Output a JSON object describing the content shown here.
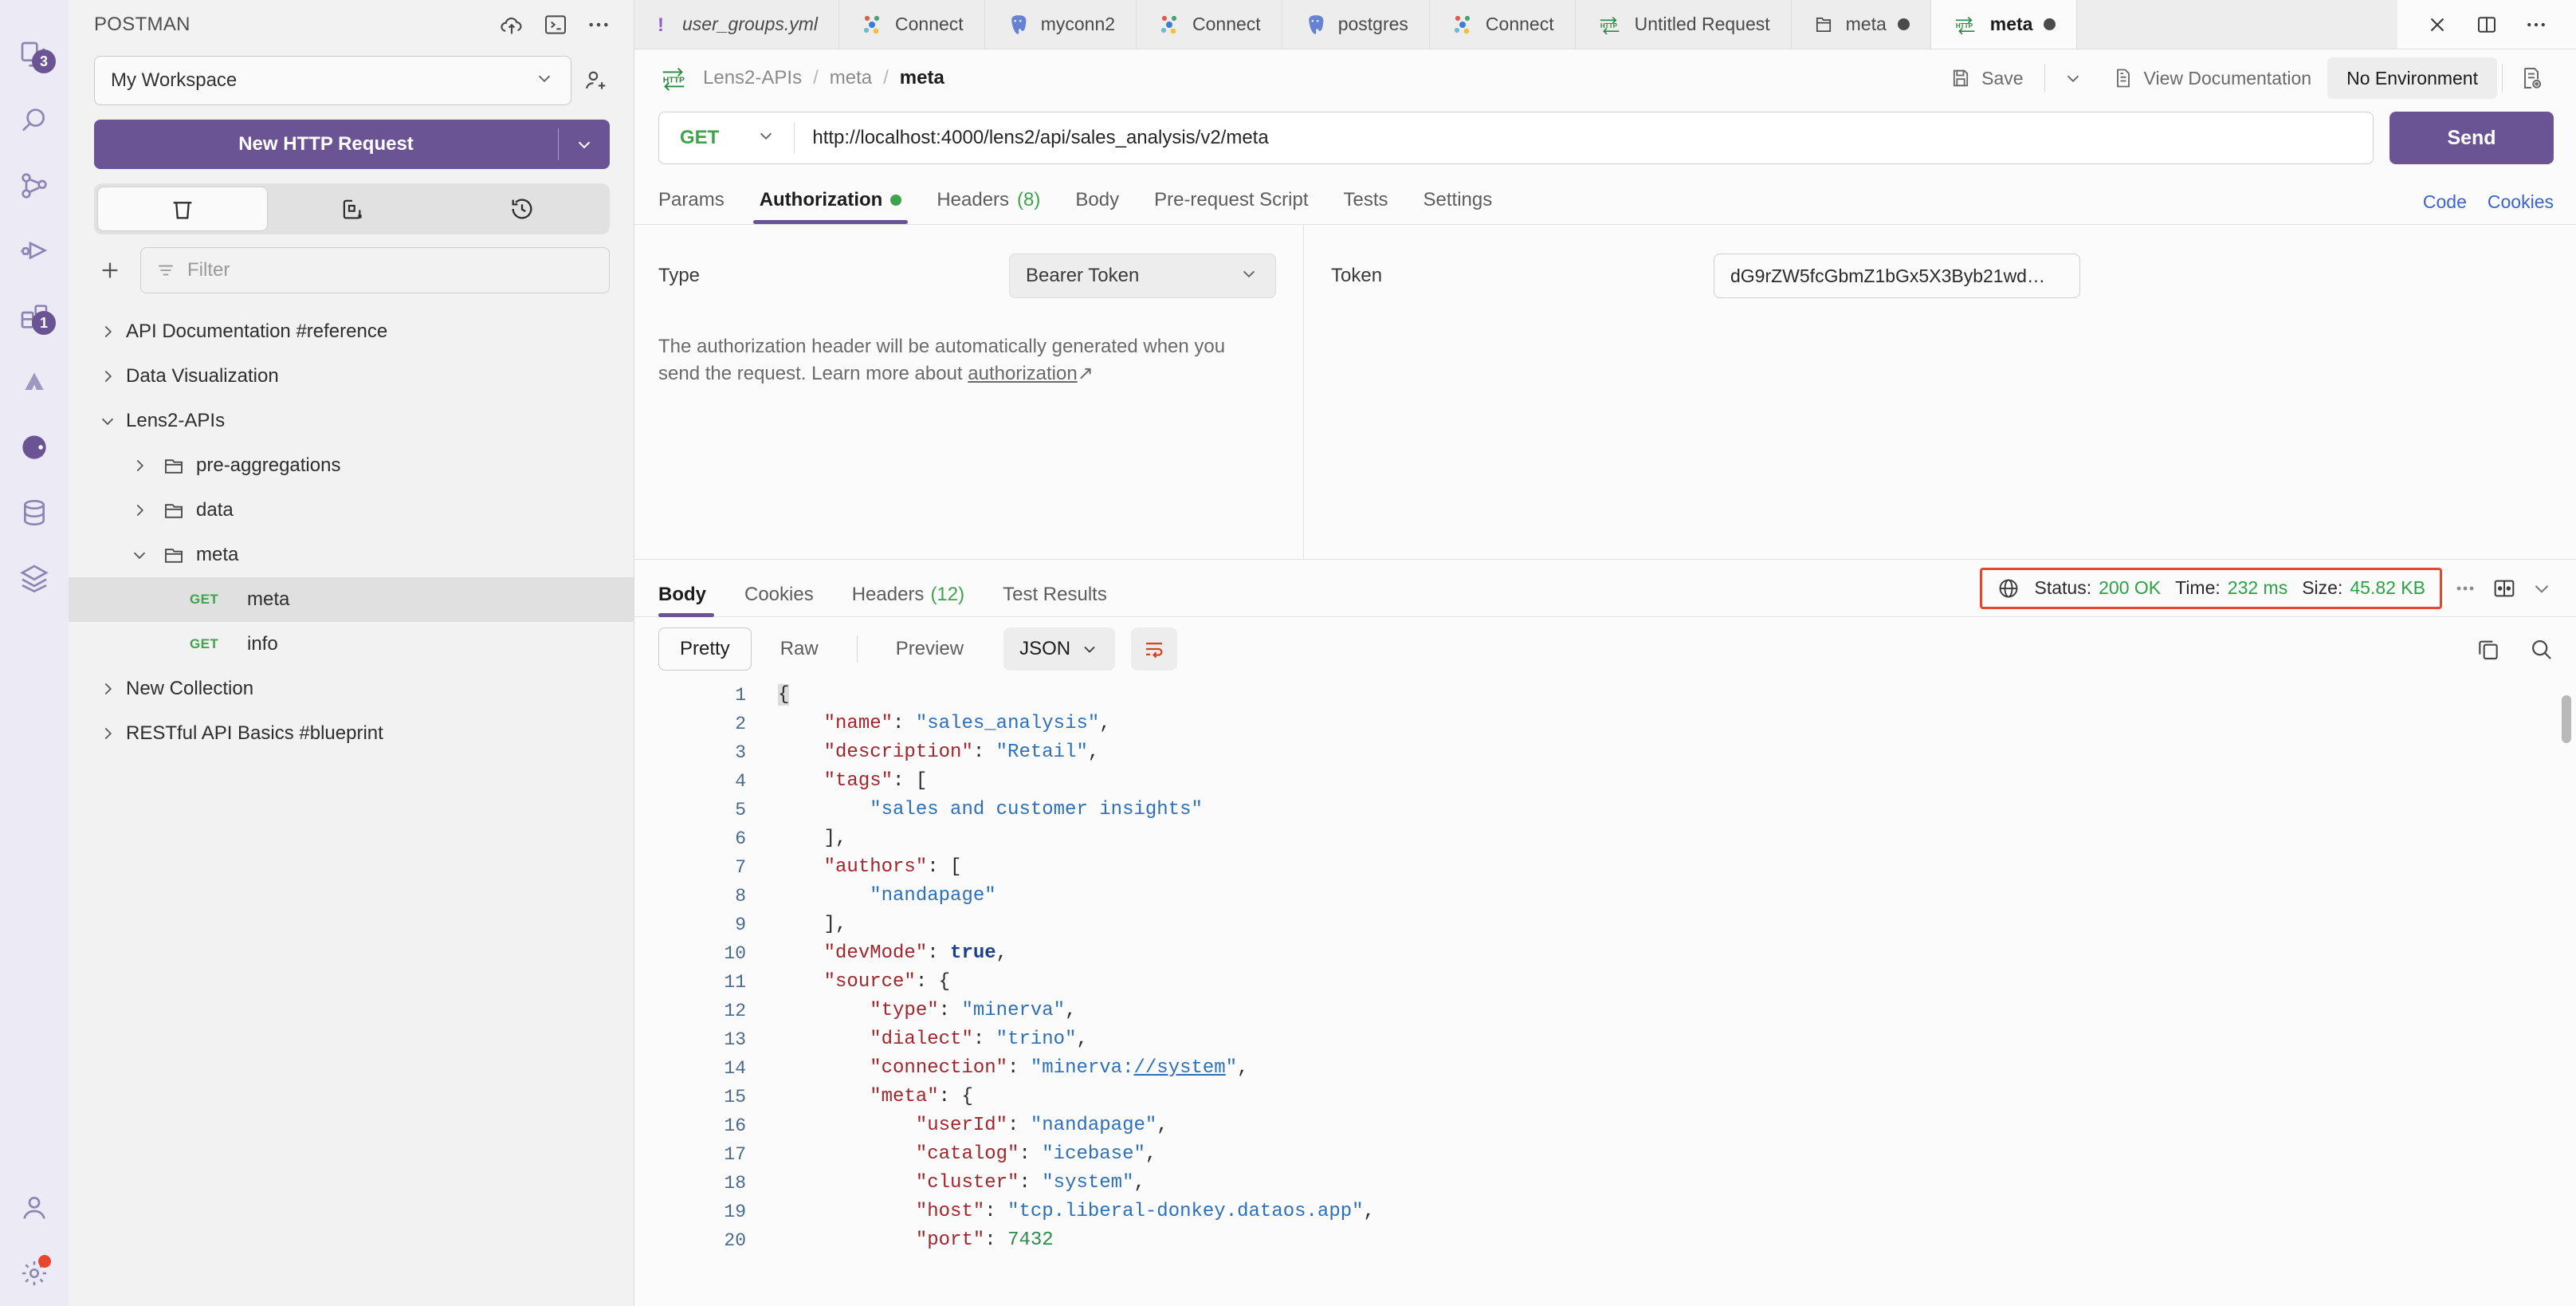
{
  "rail": {
    "items": [
      {
        "name": "collections-icon",
        "badge": "3"
      },
      {
        "name": "search-icon",
        "badge": ""
      },
      {
        "name": "apis-flow-icon",
        "badge": ""
      },
      {
        "name": "mock-debug-icon",
        "badge": ""
      },
      {
        "name": "environments-icon",
        "badge": "1"
      },
      {
        "name": "atlassian-icon",
        "badge": ""
      },
      {
        "name": "postman-flows-icon",
        "badge": ""
      },
      {
        "name": "database-icon",
        "badge": ""
      },
      {
        "name": "layers-icon",
        "badge": ""
      }
    ],
    "bottom": [
      {
        "name": "user-profile-icon"
      },
      {
        "name": "settings-gear-icon"
      },
      {
        "name": "history-clock-icon"
      }
    ]
  },
  "sidebar": {
    "title": "POSTMAN",
    "header_icons": [
      "cloud-upload-icon",
      "console-terminal-icon",
      "more-horizontal-icon"
    ],
    "workspace": {
      "label": "My Workspace",
      "chevron": "chevron-down-icon"
    },
    "invite_icon": "invite-user-icon",
    "new_request": {
      "label": "New HTTP Request",
      "caret": "chevron-down-icon"
    },
    "segments": [
      {
        "name": "trash-icon",
        "active": true
      },
      {
        "name": "new-tab-icon",
        "active": false
      },
      {
        "name": "history-icon",
        "active": false
      }
    ],
    "add_icon": "plus-icon",
    "filter": {
      "placeholder": "Filter",
      "value": "",
      "icon": "filter-lines-icon"
    },
    "tree": [
      {
        "label": "API Documentation #reference",
        "level": 0,
        "kind": "collection",
        "twisty": "chevron-right-icon",
        "selected": false
      },
      {
        "label": "Data Visualization",
        "level": 0,
        "kind": "collection",
        "twisty": "chevron-right-icon",
        "selected": false
      },
      {
        "label": "Lens2-APIs",
        "level": 0,
        "kind": "collection",
        "twisty": "chevron-down-icon",
        "selected": false
      },
      {
        "label": "pre-aggregations",
        "level": 1,
        "kind": "folder",
        "twisty": "chevron-right-icon",
        "selected": false
      },
      {
        "label": "data",
        "level": 1,
        "kind": "folder",
        "twisty": "chevron-right-icon",
        "selected": false
      },
      {
        "label": "meta",
        "level": 1,
        "kind": "folder",
        "twisty": "chevron-down-icon",
        "selected": false
      },
      {
        "label": "meta",
        "level": 2,
        "kind": "request",
        "method": "GET",
        "twisty": "",
        "selected": true
      },
      {
        "label": "info",
        "level": 2,
        "kind": "request",
        "method": "GET",
        "twisty": "",
        "selected": false
      },
      {
        "label": "New Collection",
        "level": 0,
        "kind": "collection",
        "twisty": "chevron-right-icon",
        "selected": false
      },
      {
        "label": "RESTful API Basics #blueprint",
        "level": 0,
        "kind": "collection",
        "twisty": "chevron-right-icon",
        "selected": false
      }
    ]
  },
  "tabstrip": {
    "tabs": [
      {
        "label": "user_groups.yml",
        "icon": "yaml-warning-icon",
        "active": false,
        "dirty": false,
        "italic": true
      },
      {
        "label": "Connect",
        "icon": "google-dots-icon",
        "active": false,
        "dirty": false
      },
      {
        "label": "myconn2",
        "icon": "postgres-elephant-icon",
        "active": false,
        "dirty": false
      },
      {
        "label": "Connect",
        "icon": "google-dots-icon",
        "active": false,
        "dirty": false
      },
      {
        "label": "postgres",
        "icon": "postgres-elephant-icon",
        "active": false,
        "dirty": false
      },
      {
        "label": "Connect",
        "icon": "google-dots-icon",
        "active": false,
        "dirty": false
      },
      {
        "label": "Untitled Request",
        "icon": "http-icon",
        "active": false,
        "dirty": false
      },
      {
        "label": "meta",
        "icon": "folder-icon",
        "active": false,
        "dirty": true
      },
      {
        "label": "meta",
        "icon": "http-icon",
        "active": true,
        "dirty": true
      }
    ],
    "close_icon": "close-icon",
    "split_icon": "split-pane-icon",
    "more_icon": "more-horizontal-icon"
  },
  "crumbbar": {
    "icon": "http-icon",
    "crumbs": [
      "Lens2-APIs",
      "meta"
    ],
    "current": "meta",
    "separator": "/",
    "save": {
      "label": "Save",
      "icon": "save-disk-icon",
      "caret": "chevron-down-icon"
    },
    "view_documentation": {
      "label": "View Documentation",
      "icon": "document-icon"
    },
    "environment": {
      "label": "No Environment"
    },
    "env_quicklook_icon": "environment-quicklook-icon"
  },
  "request": {
    "method": "GET",
    "method_caret": "chevron-down-icon",
    "url": "http://localhost:4000/lens2/api/sales_analysis/v2/meta",
    "url_placeholder": "Enter URL or paste text",
    "send_label": "Send",
    "tabs": [
      {
        "label": "Params",
        "active": false,
        "badge": "",
        "dot": false
      },
      {
        "label": "Authorization",
        "active": true,
        "badge": "",
        "dot": true
      },
      {
        "label": "Headers",
        "active": false,
        "badge": "(8)",
        "dot": false
      },
      {
        "label": "Body",
        "active": false,
        "badge": "",
        "dot": false
      },
      {
        "label": "Pre-request Script",
        "active": false,
        "badge": "",
        "dot": false
      },
      {
        "label": "Tests",
        "active": false,
        "badge": "",
        "dot": false
      },
      {
        "label": "Settings",
        "active": false,
        "badge": "",
        "dot": false
      }
    ],
    "code_link": "Code",
    "cookies_link": "Cookies"
  },
  "auth": {
    "type_label": "Type",
    "type_value": "Bearer Token",
    "type_caret": "chevron-down-icon",
    "help_text": "The authorization header will be automatically generated when you send the request. Learn more about ",
    "help_link": "authorization",
    "help_link_arrow": "↗",
    "token_label": "Token",
    "token_value": "dG9rZW5fcGbmZ1bGx5X3Byb21wd…"
  },
  "response": {
    "tabs": [
      {
        "label": "Body",
        "active": true,
        "badge": ""
      },
      {
        "label": "Cookies",
        "active": false,
        "badge": ""
      },
      {
        "label": "Headers",
        "active": false,
        "badge": "(12)"
      },
      {
        "label": "Test Results",
        "active": false,
        "badge": ""
      }
    ],
    "globe_icon": "globe-icon",
    "status_label": "Status:",
    "status_value": "200 OK",
    "time_label": "Time:",
    "time_value": "232 ms",
    "size_label": "Size:",
    "size_value": "45.82 KB",
    "more_icon": "more-dots-icon",
    "split_icon": "split-response-icon",
    "collapse_icon": "chevron-down-icon",
    "highlight_color": "#e8462c",
    "toolbar": {
      "pretty": "Pretty",
      "raw": "Raw",
      "preview": "Preview",
      "format": "JSON",
      "format_caret": "chevron-down-icon",
      "wrap_icon": "word-wrap-icon",
      "copy_icon": "copy-icon",
      "search_icon": "search-icon"
    },
    "body_lines": [
      {
        "n": 1,
        "fold": "",
        "tokens": [
          {
            "t": "p",
            "v": "{",
            "sel": true
          }
        ]
      },
      {
        "n": 2,
        "fold": "",
        "tokens": [
          {
            "t": "p",
            "v": "    "
          },
          {
            "t": "k",
            "v": "\"name\""
          },
          {
            "t": "p",
            "v": ": "
          },
          {
            "t": "s",
            "v": "\"sales_analysis\""
          },
          {
            "t": "p",
            "v": ","
          }
        ]
      },
      {
        "n": 3,
        "fold": "",
        "tokens": [
          {
            "t": "p",
            "v": "    "
          },
          {
            "t": "k",
            "v": "\"description\""
          },
          {
            "t": "p",
            "v": ": "
          },
          {
            "t": "s",
            "v": "\"Retail\""
          },
          {
            "t": "p",
            "v": ","
          }
        ]
      },
      {
        "n": 4,
        "fold": "",
        "tokens": [
          {
            "t": "p",
            "v": "    "
          },
          {
            "t": "k",
            "v": "\"tags\""
          },
          {
            "t": "p",
            "v": ": ["
          }
        ]
      },
      {
        "n": 5,
        "fold": "",
        "tokens": [
          {
            "t": "p",
            "v": "        "
          },
          {
            "t": "s",
            "v": "\"sales and customer insights\""
          }
        ]
      },
      {
        "n": 6,
        "fold": "",
        "tokens": [
          {
            "t": "p",
            "v": "    ],"
          }
        ]
      },
      {
        "n": 7,
        "fold": "",
        "tokens": [
          {
            "t": "p",
            "v": "    "
          },
          {
            "t": "k",
            "v": "\"authors\""
          },
          {
            "t": "p",
            "v": ": ["
          }
        ]
      },
      {
        "n": 8,
        "fold": "",
        "tokens": [
          {
            "t": "p",
            "v": "        "
          },
          {
            "t": "s",
            "v": "\"nandapage\""
          }
        ]
      },
      {
        "n": 9,
        "fold": "",
        "tokens": [
          {
            "t": "p",
            "v": "    ],"
          }
        ]
      },
      {
        "n": 10,
        "fold": "",
        "tokens": [
          {
            "t": "p",
            "v": "    "
          },
          {
            "t": "k",
            "v": "\"devMode\""
          },
          {
            "t": "p",
            "v": ": "
          },
          {
            "t": "b",
            "v": "true"
          },
          {
            "t": "p",
            "v": ","
          }
        ]
      },
      {
        "n": 11,
        "fold": "",
        "tokens": [
          {
            "t": "p",
            "v": "    "
          },
          {
            "t": "k",
            "v": "\"source\""
          },
          {
            "t": "p",
            "v": ": {"
          }
        ]
      },
      {
        "n": 12,
        "fold": "",
        "tokens": [
          {
            "t": "p",
            "v": "        "
          },
          {
            "t": "k",
            "v": "\"type\""
          },
          {
            "t": "p",
            "v": ": "
          },
          {
            "t": "s",
            "v": "\"minerva\""
          },
          {
            "t": "p",
            "v": ","
          }
        ]
      },
      {
        "n": 13,
        "fold": "",
        "tokens": [
          {
            "t": "p",
            "v": "        "
          },
          {
            "t": "k",
            "v": "\"dialect\""
          },
          {
            "t": "p",
            "v": ": "
          },
          {
            "t": "s",
            "v": "\"trino\""
          },
          {
            "t": "p",
            "v": ","
          }
        ]
      },
      {
        "n": 14,
        "fold": "",
        "tokens": [
          {
            "t": "p",
            "v": "        "
          },
          {
            "t": "k",
            "v": "\"connection\""
          },
          {
            "t": "p",
            "v": ": "
          },
          {
            "t": "s",
            "v": "\"minerva:"
          },
          {
            "t": "s ul",
            "v": "//system"
          },
          {
            "t": "s",
            "v": "\""
          },
          {
            "t": "p",
            "v": ","
          }
        ]
      },
      {
        "n": 15,
        "fold": "",
        "tokens": [
          {
            "t": "p",
            "v": "        "
          },
          {
            "t": "k",
            "v": "\"meta\""
          },
          {
            "t": "p",
            "v": ": {"
          }
        ]
      },
      {
        "n": 16,
        "fold": "",
        "tokens": [
          {
            "t": "p",
            "v": "            "
          },
          {
            "t": "k",
            "v": "\"userId\""
          },
          {
            "t": "p",
            "v": ": "
          },
          {
            "t": "s",
            "v": "\"nandapage\""
          },
          {
            "t": "p",
            "v": ","
          }
        ]
      },
      {
        "n": 17,
        "fold": "",
        "tokens": [
          {
            "t": "p",
            "v": "            "
          },
          {
            "t": "k",
            "v": "\"catalog\""
          },
          {
            "t": "p",
            "v": ": "
          },
          {
            "t": "s",
            "v": "\"icebase\""
          },
          {
            "t": "p",
            "v": ","
          }
        ]
      },
      {
        "n": 18,
        "fold": "",
        "tokens": [
          {
            "t": "p",
            "v": "            "
          },
          {
            "t": "k",
            "v": "\"cluster\""
          },
          {
            "t": "p",
            "v": ": "
          },
          {
            "t": "s",
            "v": "\"system\""
          },
          {
            "t": "p",
            "v": ","
          }
        ]
      },
      {
        "n": 19,
        "fold": "",
        "tokens": [
          {
            "t": "p",
            "v": "            "
          },
          {
            "t": "k",
            "v": "\"host\""
          },
          {
            "t": "p",
            "v": ": "
          },
          {
            "t": "s",
            "v": "\"tcp.liberal-donkey.dataos.app\""
          },
          {
            "t": "p",
            "v": ","
          }
        ]
      },
      {
        "n": 20,
        "fold": "",
        "tokens": [
          {
            "t": "p",
            "v": "            "
          },
          {
            "t": "k",
            "v": "\"port\""
          },
          {
            "t": "p",
            "v": ": "
          },
          {
            "t": "n",
            "v": "7432"
          }
        ]
      }
    ]
  }
}
